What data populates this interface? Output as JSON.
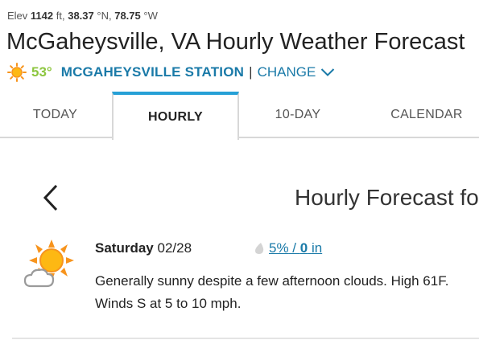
{
  "location": {
    "elev_prefix": "Elev",
    "elev_value": "1142",
    "elev_unit": "ft,",
    "lat_value": "38.37",
    "lat_unit": "°N,",
    "lon_value": "78.75",
    "lon_unit": "°W",
    "title": "McGaheysville, VA Hourly Weather Forecast"
  },
  "current": {
    "icon": "sun-icon",
    "temp": "53°",
    "station": "MCGAHEYSVILLE STATION",
    "separator": "|",
    "change_label": "CHANGE"
  },
  "tabs": [
    {
      "label": "TODAY",
      "active": false
    },
    {
      "label": "HOURLY",
      "active": true
    },
    {
      "label": "10-DAY",
      "active": false
    },
    {
      "label": "CALENDAR",
      "active": false
    }
  ],
  "forecast": {
    "title": "Hourly Forecast fo",
    "day_name": "Saturday",
    "day_date": "02/28",
    "icon": "partly-sunny-icon",
    "precip_pct": "5%",
    "precip_sep": " / ",
    "precip_amount": "0",
    "precip_unit": "in",
    "description": "Generally sunny despite a few afternoon clouds. High 61F. Winds S at 5 to 10 mph."
  },
  "colors": {
    "accent_blue": "#1a7aa8",
    "tab_active_border": "#26a0d6",
    "temp_green": "#8dc63f",
    "sun_orange": "#f7941d"
  }
}
